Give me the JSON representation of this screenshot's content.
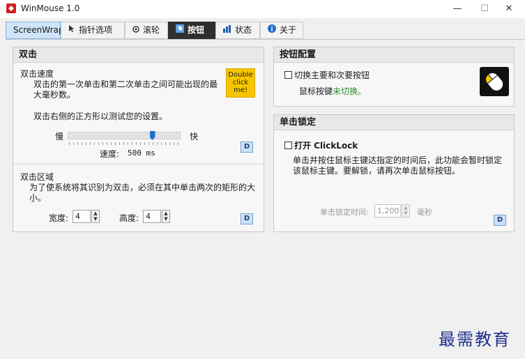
{
  "window": {
    "title": "WinMouse 1.0",
    "minimize": "—",
    "maximize": "☐",
    "close": "✕"
  },
  "tabs": [
    {
      "label": "ScreenWrap",
      "icon": ""
    },
    {
      "label": "指针选项",
      "icon": "pointer-icon"
    },
    {
      "label": "滚轮",
      "icon": "wheel-icon"
    },
    {
      "label": "按钮",
      "icon": "mouse-button-icon"
    },
    {
      "label": "状态",
      "icon": "chart-icon"
    },
    {
      "label": "关于",
      "icon": "info-icon"
    }
  ],
  "dblclick": {
    "header": "双击",
    "speed": {
      "title": "双击速度",
      "desc": "双击的第一次单击和第二次单击之间可能出现的最大毫秒数。",
      "test_hint": "双击右侧的正方形以测试您的设置。",
      "test_square": [
        "Double",
        "click",
        "me!"
      ],
      "slow": "慢",
      "fast": "快",
      "speed_label": "速度:",
      "speed_value": "500 ms",
      "speed_level": 0.75,
      "default_btn": "D"
    },
    "area": {
      "title": "双击区域",
      "desc": "为了使系统将其识别为双击，必须在其中单击两次的矩形的大小。",
      "width_label": "宽度:",
      "width_value": "4",
      "height_label": "高度:",
      "height_value": "4",
      "default_btn": "D"
    }
  },
  "buttons": {
    "header": "按钮配置",
    "swap_label": "切换主要和次要按钮",
    "swap_checked": false,
    "status_prefix": "鼠标按键",
    "status_value": "未切换。"
  },
  "clicklock": {
    "header": "单击锁定",
    "enable_label": "打开 ClickLock",
    "enable_checked": false,
    "desc": "单击并按住鼠标主键达指定的时间后，此功能会暂时锁定该鼠标主键。要解锁，请再次单击鼠标按钮。",
    "time_label": "单击锁定时间:",
    "time_value": "1,200",
    "time_unit": "毫秒",
    "default_btn": "D"
  },
  "watermark": "最需教育"
}
